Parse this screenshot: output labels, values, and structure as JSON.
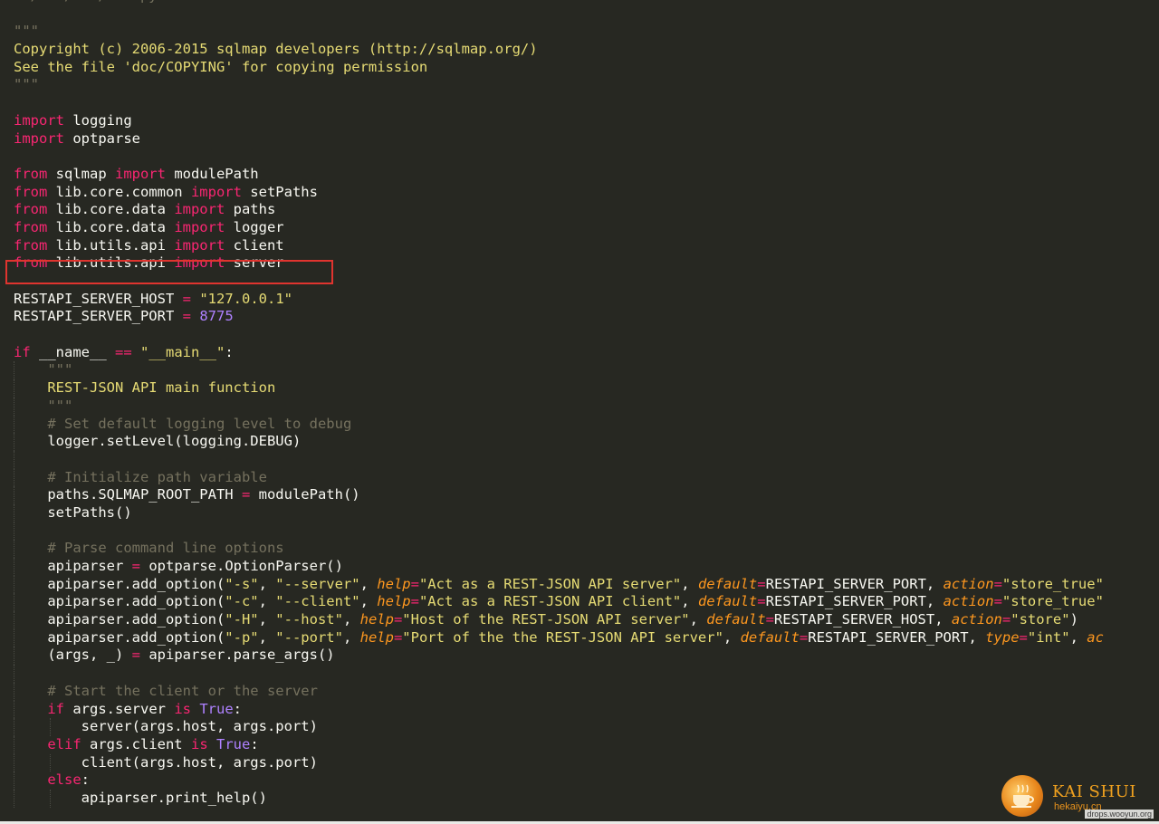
{
  "code_lines": [
    {
      "indent": 0,
      "tokens": [
        {
          "t": "#!/usr/bin/env python",
          "c": "comment"
        }
      ]
    },
    {
      "indent": 0,
      "tokens": []
    },
    {
      "indent": 0,
      "tokens": [
        {
          "t": "\"\"\"",
          "c": "comment"
        }
      ]
    },
    {
      "indent": 0,
      "tokens": [
        {
          "t": "Copyright (c) 2006-2015 sqlmap developers (http://sqlmap.org/)",
          "c": "string"
        }
      ]
    },
    {
      "indent": 0,
      "tokens": [
        {
          "t": "See the file 'doc/COPYING' for copying permission",
          "c": "string"
        }
      ]
    },
    {
      "indent": 0,
      "tokens": [
        {
          "t": "\"\"\"",
          "c": "comment"
        }
      ]
    },
    {
      "indent": 0,
      "tokens": []
    },
    {
      "indent": 0,
      "tokens": [
        {
          "t": "import",
          "c": "keyword"
        },
        {
          "t": " logging",
          "c": "plain"
        }
      ]
    },
    {
      "indent": 0,
      "tokens": [
        {
          "t": "import",
          "c": "keyword"
        },
        {
          "t": " optparse",
          "c": "plain"
        }
      ]
    },
    {
      "indent": 0,
      "tokens": []
    },
    {
      "indent": 0,
      "tokens": [
        {
          "t": "from",
          "c": "keyword"
        },
        {
          "t": " sqlmap ",
          "c": "plain"
        },
        {
          "t": "import",
          "c": "keyword"
        },
        {
          "t": " modulePath",
          "c": "plain"
        }
      ]
    },
    {
      "indent": 0,
      "tokens": [
        {
          "t": "from",
          "c": "keyword"
        },
        {
          "t": " lib.core.common ",
          "c": "plain"
        },
        {
          "t": "import",
          "c": "keyword"
        },
        {
          "t": " setPaths",
          "c": "plain"
        }
      ]
    },
    {
      "indent": 0,
      "tokens": [
        {
          "t": "from",
          "c": "keyword"
        },
        {
          "t": " lib.core.data ",
          "c": "plain"
        },
        {
          "t": "import",
          "c": "keyword"
        },
        {
          "t": " paths",
          "c": "plain"
        }
      ]
    },
    {
      "indent": 0,
      "tokens": [
        {
          "t": "from",
          "c": "keyword"
        },
        {
          "t": " lib.core.data ",
          "c": "plain"
        },
        {
          "t": "import",
          "c": "keyword"
        },
        {
          "t": " logger",
          "c": "plain"
        }
      ]
    },
    {
      "indent": 0,
      "tokens": [
        {
          "t": "from",
          "c": "keyword"
        },
        {
          "t": " lib.utils.api ",
          "c": "plain"
        },
        {
          "t": "import",
          "c": "keyword"
        },
        {
          "t": " client",
          "c": "plain"
        }
      ]
    },
    {
      "indent": 0,
      "tokens": [
        {
          "t": "from",
          "c": "keyword"
        },
        {
          "t": " lib.utils.api ",
          "c": "plain"
        },
        {
          "t": "import",
          "c": "keyword"
        },
        {
          "t": " server",
          "c": "plain"
        }
      ]
    },
    {
      "indent": 0,
      "tokens": []
    },
    {
      "indent": 0,
      "tokens": [
        {
          "t": "RESTAPI_SERVER_HOST ",
          "c": "plain"
        },
        {
          "t": "=",
          "c": "keyword"
        },
        {
          "t": " ",
          "c": "plain"
        },
        {
          "t": "\"127.0.0.1\"",
          "c": "string"
        }
      ]
    },
    {
      "indent": 0,
      "tokens": [
        {
          "t": "RESTAPI_SERVER_PORT ",
          "c": "plain"
        },
        {
          "t": "=",
          "c": "keyword"
        },
        {
          "t": " ",
          "c": "plain"
        },
        {
          "t": "8775",
          "c": "number"
        }
      ]
    },
    {
      "indent": 0,
      "tokens": []
    },
    {
      "indent": 0,
      "tokens": [
        {
          "t": "if",
          "c": "keyword"
        },
        {
          "t": " __name__ ",
          "c": "plain"
        },
        {
          "t": "==",
          "c": "keyword"
        },
        {
          "t": " ",
          "c": "plain"
        },
        {
          "t": "\"__main__\"",
          "c": "string"
        },
        {
          "t": ":",
          "c": "plain"
        }
      ]
    },
    {
      "indent": 1,
      "tokens": [
        {
          "t": "\"\"\"",
          "c": "comment"
        }
      ]
    },
    {
      "indent": 1,
      "tokens": [
        {
          "t": "REST-JSON API main function",
          "c": "string"
        }
      ]
    },
    {
      "indent": 1,
      "tokens": [
        {
          "t": "\"\"\"",
          "c": "comment"
        }
      ]
    },
    {
      "indent": 1,
      "tokens": [
        {
          "t": "# Set default logging level to debug",
          "c": "comment"
        }
      ]
    },
    {
      "indent": 1,
      "tokens": [
        {
          "t": "logger.setLevel(logging.DEBUG)",
          "c": "plain"
        }
      ]
    },
    {
      "indent": 1,
      "tokens": []
    },
    {
      "indent": 1,
      "tokens": [
        {
          "t": "# Initialize path variable",
          "c": "comment"
        }
      ]
    },
    {
      "indent": 1,
      "tokens": [
        {
          "t": "paths.SQLMAP_ROOT_PATH ",
          "c": "plain"
        },
        {
          "t": "=",
          "c": "keyword"
        },
        {
          "t": " modulePath()",
          "c": "plain"
        }
      ]
    },
    {
      "indent": 1,
      "tokens": [
        {
          "t": "setPaths()",
          "c": "plain"
        }
      ]
    },
    {
      "indent": 1,
      "tokens": []
    },
    {
      "indent": 1,
      "tokens": [
        {
          "t": "# Parse command line options",
          "c": "comment"
        }
      ]
    },
    {
      "indent": 1,
      "tokens": [
        {
          "t": "apiparser ",
          "c": "plain"
        },
        {
          "t": "=",
          "c": "keyword"
        },
        {
          "t": " optparse.OptionParser()",
          "c": "plain"
        }
      ]
    },
    {
      "indent": 1,
      "tokens": [
        {
          "t": "apiparser.add_option(",
          "c": "plain"
        },
        {
          "t": "\"-s\"",
          "c": "string"
        },
        {
          "t": ", ",
          "c": "plain"
        },
        {
          "t": "\"--server\"",
          "c": "string"
        },
        {
          "t": ", ",
          "c": "plain"
        },
        {
          "t": "help",
          "c": "param"
        },
        {
          "t": "=",
          "c": "keyword"
        },
        {
          "t": "\"Act as a REST-JSON API server\"",
          "c": "string"
        },
        {
          "t": ", ",
          "c": "plain"
        },
        {
          "t": "default",
          "c": "param"
        },
        {
          "t": "=",
          "c": "keyword"
        },
        {
          "t": "RESTAPI_SERVER_PORT, ",
          "c": "plain"
        },
        {
          "t": "action",
          "c": "param"
        },
        {
          "t": "=",
          "c": "keyword"
        },
        {
          "t": "\"store_true\"",
          "c": "string"
        }
      ]
    },
    {
      "indent": 1,
      "tokens": [
        {
          "t": "apiparser.add_option(",
          "c": "plain"
        },
        {
          "t": "\"-c\"",
          "c": "string"
        },
        {
          "t": ", ",
          "c": "plain"
        },
        {
          "t": "\"--client\"",
          "c": "string"
        },
        {
          "t": ", ",
          "c": "plain"
        },
        {
          "t": "help",
          "c": "param"
        },
        {
          "t": "=",
          "c": "keyword"
        },
        {
          "t": "\"Act as a REST-JSON API client\"",
          "c": "string"
        },
        {
          "t": ", ",
          "c": "plain"
        },
        {
          "t": "default",
          "c": "param"
        },
        {
          "t": "=",
          "c": "keyword"
        },
        {
          "t": "RESTAPI_SERVER_PORT, ",
          "c": "plain"
        },
        {
          "t": "action",
          "c": "param"
        },
        {
          "t": "=",
          "c": "keyword"
        },
        {
          "t": "\"store_true\"",
          "c": "string"
        }
      ]
    },
    {
      "indent": 1,
      "tokens": [
        {
          "t": "apiparser.add_option(",
          "c": "plain"
        },
        {
          "t": "\"-H\"",
          "c": "string"
        },
        {
          "t": ", ",
          "c": "plain"
        },
        {
          "t": "\"--host\"",
          "c": "string"
        },
        {
          "t": ", ",
          "c": "plain"
        },
        {
          "t": "help",
          "c": "param"
        },
        {
          "t": "=",
          "c": "keyword"
        },
        {
          "t": "\"Host of the REST-JSON API server\"",
          "c": "string"
        },
        {
          "t": ", ",
          "c": "plain"
        },
        {
          "t": "default",
          "c": "param"
        },
        {
          "t": "=",
          "c": "keyword"
        },
        {
          "t": "RESTAPI_SERVER_HOST, ",
          "c": "plain"
        },
        {
          "t": "action",
          "c": "param"
        },
        {
          "t": "=",
          "c": "keyword"
        },
        {
          "t": "\"store\"",
          "c": "string"
        },
        {
          "t": ")",
          "c": "plain"
        }
      ]
    },
    {
      "indent": 1,
      "tokens": [
        {
          "t": "apiparser.add_option(",
          "c": "plain"
        },
        {
          "t": "\"-p\"",
          "c": "string"
        },
        {
          "t": ", ",
          "c": "plain"
        },
        {
          "t": "\"--port\"",
          "c": "string"
        },
        {
          "t": ", ",
          "c": "plain"
        },
        {
          "t": "help",
          "c": "param"
        },
        {
          "t": "=",
          "c": "keyword"
        },
        {
          "t": "\"Port of the the REST-JSON API server\"",
          "c": "string"
        },
        {
          "t": ", ",
          "c": "plain"
        },
        {
          "t": "default",
          "c": "param"
        },
        {
          "t": "=",
          "c": "keyword"
        },
        {
          "t": "RESTAPI_SERVER_PORT, ",
          "c": "plain"
        },
        {
          "t": "type",
          "c": "param"
        },
        {
          "t": "=",
          "c": "keyword"
        },
        {
          "t": "\"int\"",
          "c": "string"
        },
        {
          "t": ", ",
          "c": "plain"
        },
        {
          "t": "ac",
          "c": "param"
        }
      ]
    },
    {
      "indent": 1,
      "tokens": [
        {
          "t": "(args, _) ",
          "c": "plain"
        },
        {
          "t": "=",
          "c": "keyword"
        },
        {
          "t": " apiparser.parse_args()",
          "c": "plain"
        }
      ]
    },
    {
      "indent": 1,
      "tokens": []
    },
    {
      "indent": 1,
      "tokens": [
        {
          "t": "# Start the client or the server",
          "c": "comment"
        }
      ]
    },
    {
      "indent": 1,
      "tokens": [
        {
          "t": "if",
          "c": "keyword"
        },
        {
          "t": " args.server ",
          "c": "plain"
        },
        {
          "t": "is",
          "c": "keyword"
        },
        {
          "t": " ",
          "c": "plain"
        },
        {
          "t": "True",
          "c": "builtin"
        },
        {
          "t": ":",
          "c": "plain"
        }
      ]
    },
    {
      "indent": 2,
      "tokens": [
        {
          "t": "server(args.host, args.port)",
          "c": "plain"
        }
      ]
    },
    {
      "indent": 1,
      "tokens": [
        {
          "t": "elif",
          "c": "keyword"
        },
        {
          "t": " args.client ",
          "c": "plain"
        },
        {
          "t": "is",
          "c": "keyword"
        },
        {
          "t": " ",
          "c": "plain"
        },
        {
          "t": "True",
          "c": "builtin"
        },
        {
          "t": ":",
          "c": "plain"
        }
      ]
    },
    {
      "indent": 2,
      "tokens": [
        {
          "t": "client(args.host, args.port)",
          "c": "plain"
        }
      ]
    },
    {
      "indent": 1,
      "tokens": [
        {
          "t": "else",
          "c": "keyword"
        },
        {
          "t": ":",
          "c": "plain"
        }
      ]
    },
    {
      "indent": 2,
      "tokens": [
        {
          "t": "apiparser.print_help()",
          "c": "plain"
        }
      ]
    }
  ],
  "highlighted_line": 15,
  "watermark": {
    "title": "KAI SHUI",
    "url": "hekaiyu.cn",
    "domain": "drops.wooyun.org"
  },
  "colors": {
    "background": "#272822",
    "highlight_box": "#e0342f",
    "comment": "#75715e",
    "string": "#e6db74",
    "keyword": "#f92672",
    "number": "#ae81ff",
    "param": "#fd971f"
  }
}
